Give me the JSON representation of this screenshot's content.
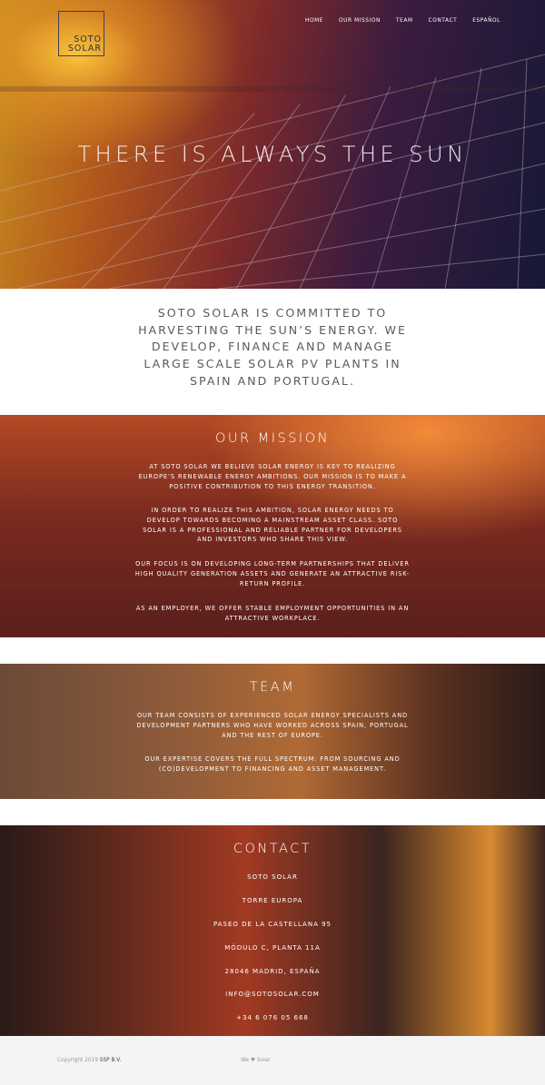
{
  "brand": {
    "logo_line1": "SOTO",
    "logo_line2": "SOLAR"
  },
  "nav": {
    "items": [
      "HOME",
      "OUR MISSION",
      "TEAM",
      "CONTACT",
      "ESPAÑOL"
    ]
  },
  "hero": {
    "title": "THERE IS ALWAYS THE SUN"
  },
  "intro": {
    "text": "SOTO SOLAR IS COMMITTED TO HARVESTING THE SUN’S ENERGY. WE DEVELOP, FINANCE AND MANAGE LARGE SCALE SOLAR PV PLANTS IN SPAIN AND PORTUGAL."
  },
  "mission": {
    "title": "OUR MISSION",
    "paragraphs": [
      "AT SOTO SOLAR WE BELIEVE SOLAR ENERGY IS KEY TO REALIZING EUROPE’S RENEWABLE ENERGY AMBITIONS. OUR MISSION IS TO MAKE A POSITIVE CONTRIBUTION TO THIS ENERGY TRANSITION.",
      "IN ORDER TO REALIZE THIS AMBITION, SOLAR ENERGY NEEDS TO DEVELOP TOWARDS BECOMING A MAINSTREAM ASSET CLASS. SOTO SOLAR IS A PROFESSIONAL AND RELIABLE PARTNER FOR DEVELOPERS AND INVESTORS WHO SHARE THIS VIEW.",
      "OUR FOCUS IS ON DEVELOPING LONG-TERM PARTNERSHIPS THAT DELIVER HIGH QUALITY GENERATION ASSETS AND GENERATE AN ATTRACTIVE RISK-RETURN PROFILE.",
      "AS AN EMPLOYER, WE OFFER STABLE EMPLOYMENT OPPORTUNITIES IN AN ATTRACTIVE WORKPLACE."
    ]
  },
  "team": {
    "title": "TEAM",
    "paragraphs": [
      "OUR TEAM CONSISTS OF EXPERIENCED SOLAR ENERGY SPECIALISTS AND DEVELOPMENT PARTNERS WHO HAVE WORKED ACROSS SPAIN, PORTUGAL AND THE REST OF EUROPE.",
      "OUR EXPERTISE COVERS THE FULL SPECTRUM: FROM SOURCING AND (CO)DEVELOPMENT TO FINANCING AND ASSET MANAGEMENT."
    ]
  },
  "contact": {
    "title": "CONTACT",
    "lines": [
      "SOTO SOLAR",
      "TORRE EUROPA",
      "PASEO DE LA CASTELLANA 95",
      "MÓDULO C, PLANTA 11A",
      "28046 MADRID, ESPAÑA",
      "INFO@SOTOSOLAR.COM",
      "+34 6 076 05 668"
    ]
  },
  "footer": {
    "copyright_prefix": "Copyright 2019",
    "copyright_owner": "SSP B.V.",
    "love_prefix": "We",
    "love_suffix": "Solar",
    "heart_icon": "heart-icon"
  }
}
